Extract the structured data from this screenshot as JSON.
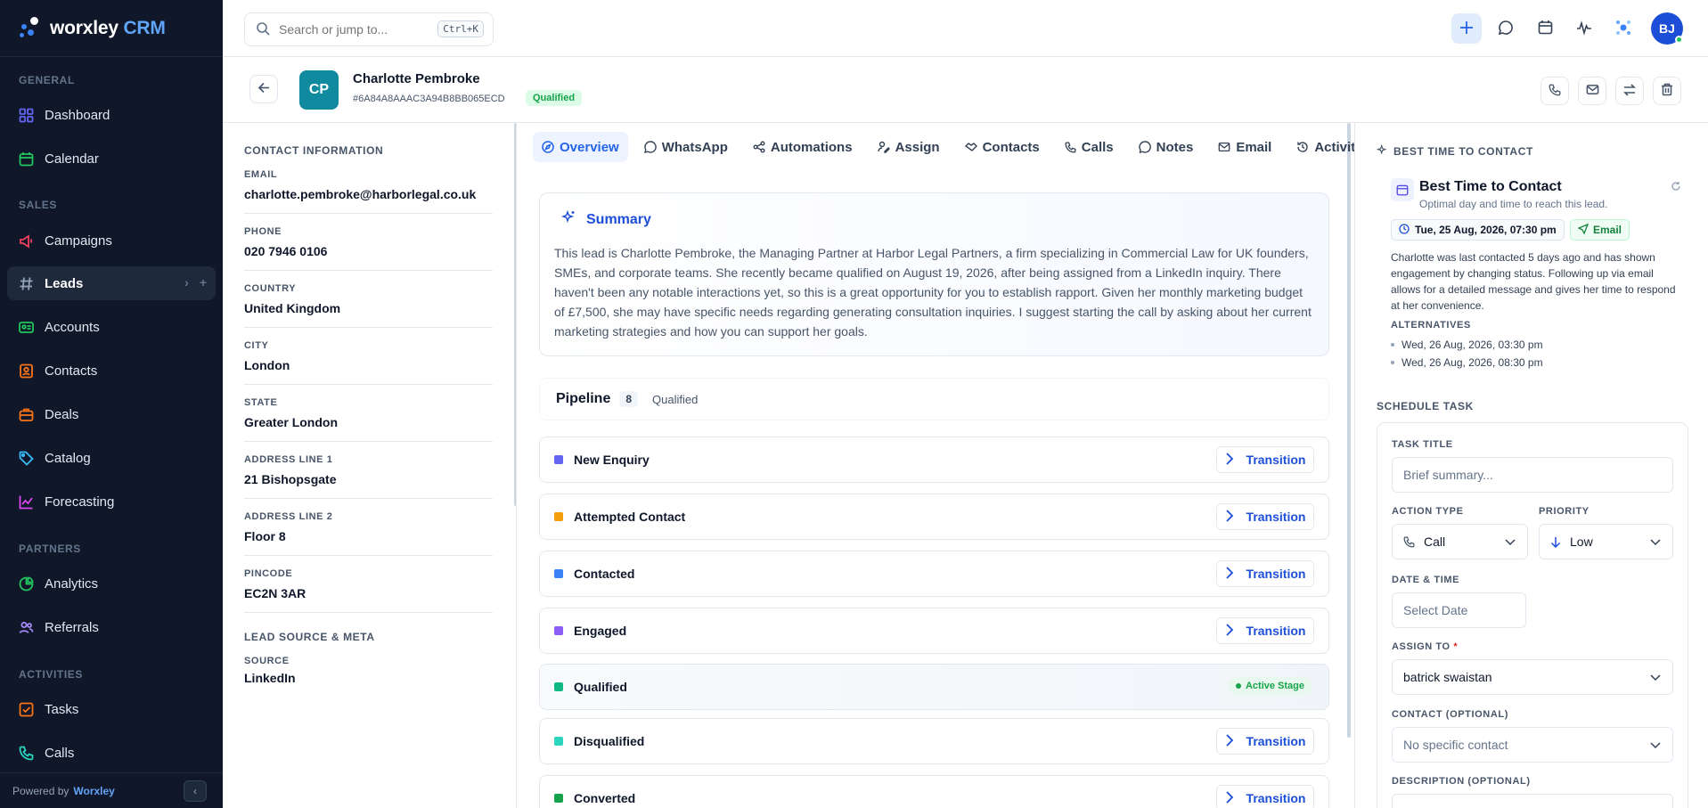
{
  "brand": {
    "name": "worxley",
    "suffix": "CRM"
  },
  "sidebar": {
    "sections": [
      {
        "label": "GENERAL"
      },
      {
        "label": "SALES"
      },
      {
        "label": "PARTNERS"
      },
      {
        "label": "ACTIVITIES"
      }
    ],
    "items": [
      {
        "label": "Dashboard",
        "icon": "grid-icon",
        "color": "#6366f1"
      },
      {
        "label": "Calendar",
        "icon": "calendar-icon",
        "color": "#22c55e"
      },
      {
        "label": "Campaigns",
        "icon": "megaphone-icon",
        "color": "#f43f5e"
      },
      {
        "label": "Leads",
        "icon": "hash-icon",
        "color": "#94a3b8"
      },
      {
        "label": "Accounts",
        "icon": "id-card-icon",
        "color": "#22c55e"
      },
      {
        "label": "Contacts",
        "icon": "contact-book-icon",
        "color": "#f97316"
      },
      {
        "label": "Deals",
        "icon": "briefcase-icon",
        "color": "#f97316"
      },
      {
        "label": "Catalog",
        "icon": "tag-icon",
        "color": "#38bdf8"
      },
      {
        "label": "Forecasting",
        "icon": "chart-line-icon",
        "color": "#d946ef"
      },
      {
        "label": "Analytics",
        "icon": "pie-chart-icon",
        "color": "#22c55e"
      },
      {
        "label": "Referrals",
        "icon": "users-icon",
        "color": "#a78bfa"
      },
      {
        "label": "Tasks",
        "icon": "checkbox-icon",
        "color": "#f97316"
      },
      {
        "label": "Calls",
        "icon": "phone-icon",
        "color": "#2dd4bf"
      }
    ],
    "footer": {
      "powered_by": "Powered by",
      "company": "Worxley"
    }
  },
  "topbar": {
    "search_placeholder": "Search or jump to...",
    "shortcut": "Ctrl+K",
    "user_initials": "BJ"
  },
  "lead": {
    "initials": "CP",
    "name": "Charlotte Pembroke",
    "id": "#6A84A8AAAC3A94B8BB065ECD",
    "status": "Qualified"
  },
  "contact_info": {
    "title": "CONTACT INFORMATION",
    "fields": [
      {
        "label": "EMAIL",
        "value": "charlotte.pembroke@harborlegal.co.uk"
      },
      {
        "label": "PHONE",
        "value": "020 7946 0106"
      },
      {
        "label": "COUNTRY",
        "value": "United Kingdom"
      },
      {
        "label": "CITY",
        "value": "London"
      },
      {
        "label": "STATE",
        "value": "Greater London"
      },
      {
        "label": "ADDRESS LINE 1",
        "value": "21 Bishopsgate"
      },
      {
        "label": "ADDRESS LINE 2",
        "value": "Floor 8"
      },
      {
        "label": "PINCODE",
        "value": "EC2N 3AR"
      }
    ],
    "meta_title": "LEAD SOURCE & META",
    "meta_fields": [
      {
        "label": "SOURCE",
        "value": "LinkedIn"
      }
    ]
  },
  "tabs": [
    {
      "label": "Overview",
      "icon": "compass-icon"
    },
    {
      "label": "WhatsApp",
      "icon": "whatsapp-icon"
    },
    {
      "label": "Automations",
      "icon": "share-nodes-icon"
    },
    {
      "label": "Assign",
      "icon": "user-pen-icon"
    },
    {
      "label": "Contacts",
      "icon": "handshake-icon"
    },
    {
      "label": "Calls",
      "icon": "phone-icon"
    },
    {
      "label": "Notes",
      "icon": "speech-bubble-icon"
    },
    {
      "label": "Email",
      "icon": "mail-icon"
    },
    {
      "label": "Activity",
      "icon": "history-icon"
    }
  ],
  "summary": {
    "title": "Summary",
    "text": "This lead is Charlotte Pembroke, the Managing Partner at Harbor Legal Partners, a firm specializing in Commercial Law for UK founders, SMEs, and corporate teams. She recently became qualified on August 19, 2026, after being assigned from a LinkedIn inquiry. There haven't been any notable interactions yet, so this is a great opportunity for you to establish rapport. Given her monthly marketing budget of £7,500, she may have specific needs regarding generating consultation inquiries. I suggest starting the call by asking about her current marketing strategies and how you can support her goals."
  },
  "pipeline": {
    "title": "Pipeline",
    "count": "8",
    "current": "Qualified",
    "transition_label": "Transition",
    "active_label": "Active Stage",
    "stages": [
      {
        "name": "New Enquiry",
        "color": "#6366f1"
      },
      {
        "name": "Attempted Contact",
        "color": "#f59e0b"
      },
      {
        "name": "Contacted",
        "color": "#3b82f6"
      },
      {
        "name": "Engaged",
        "color": "#8b5cf6"
      },
      {
        "name": "Qualified",
        "color": "#10b981"
      },
      {
        "name": "Disqualified",
        "color": "#2dd4bf"
      },
      {
        "name": "Converted",
        "color": "#16a34a"
      }
    ]
  },
  "best_time": {
    "section": "BEST TIME TO CONTACT",
    "title": "Best Time to Contact",
    "subtitle": "Optimal day and time to reach this lead.",
    "time": "Tue, 25 Aug, 2026, 07:30 pm",
    "channel": "Email",
    "text": "Charlotte was last contacted 5 days ago and has shown engagement by changing status. Following up via email allows for a detailed message and gives her time to respond at her convenience.",
    "alternatives_label": "ALTERNATIVES",
    "alternatives": [
      "Wed, 26 Aug, 2026, 03:30 pm",
      "Wed, 26 Aug, 2026, 08:30 pm"
    ]
  },
  "schedule": {
    "section": "SCHEDULE TASK",
    "task_title_label": "TASK TITLE",
    "task_title_placeholder": "Brief summary...",
    "action_type_label": "ACTION TYPE",
    "action_type_value": "Call",
    "priority_label": "PRIORITY",
    "priority_value": "Low",
    "datetime_label": "DATE & TIME",
    "datetime_placeholder": "Select Date",
    "assign_label": "ASSIGN TO",
    "assign_required": "*",
    "assign_value": "batrick swaistan",
    "contact_label": "CONTACT (OPTIONAL)",
    "contact_value": "No specific contact",
    "description_label": "DESCRIPTION (OPTIONAL)"
  }
}
